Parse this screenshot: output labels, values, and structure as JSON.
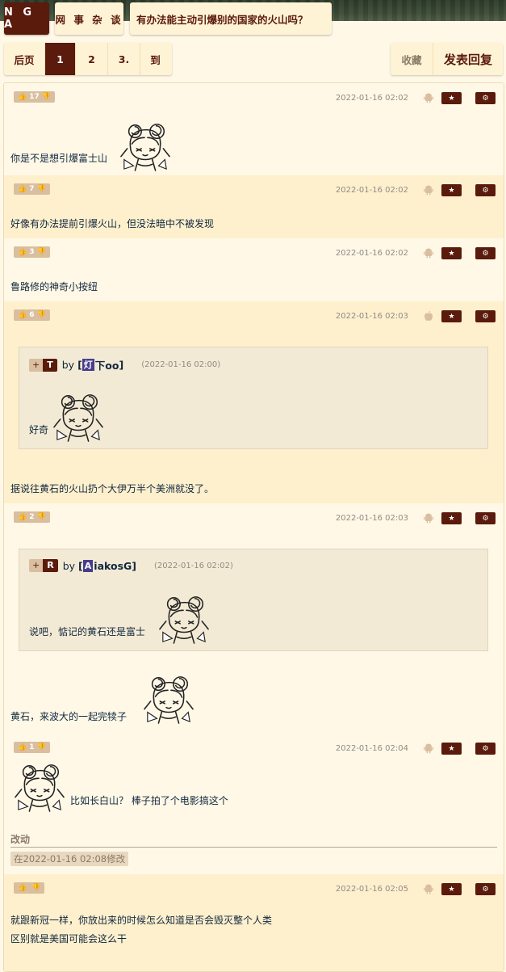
{
  "header": {
    "logo": "N G A",
    "forum": "网 事 杂 谈",
    "topic_title": "有办法能主动引爆别的国家的火山吗？"
  },
  "pager": {
    "prev_label": "后页",
    "pages": [
      "1",
      "2",
      "3."
    ],
    "current": "1",
    "goto_label": "到"
  },
  "actions": {
    "favorite_label": "收藏",
    "reply_label": "发表回复"
  },
  "colors": {
    "brand": "#5a1a0c",
    "bg_light": "#fff8e6",
    "bg_alt": "#fff0cd",
    "quote_bg": "#f3ead5"
  },
  "posts": [
    {
      "likes": "17",
      "date": "2022-01-16 02:02",
      "device": "android-icon",
      "content": "你是不是想引爆富士山"
    },
    {
      "likes": "7",
      "date": "2022-01-16 02:02",
      "device": "android-icon",
      "content": "好像有办法提前引爆火山，但没法暗中不被发现"
    },
    {
      "likes": "3",
      "date": "2022-01-16 02:02",
      "device": "android-icon",
      "content": "鲁路修的神奇小按纽"
    },
    {
      "likes": "6",
      "date": "2022-01-16 02:03",
      "device": "apple-icon",
      "quote": {
        "tag": "T",
        "by": "by",
        "user_avatar": "灯",
        "user": "下oo",
        "date": "(2022-01-16 02:00)",
        "text": "好奇"
      },
      "content": "据说往黄石的火山扔个大伊万半个美洲就没了。"
    },
    {
      "likes": "2",
      "date": "2022-01-16 02:03",
      "device": "android-icon",
      "quote": {
        "tag": "R",
        "by": "by",
        "user_avatar": "A",
        "user": "iakosG",
        "date": "(2022-01-16 02:02)",
        "text": "说吧，惦记的黄石还是富士"
      },
      "content": "黄石，来波大的一起完犊子"
    },
    {
      "likes": "1",
      "date": "2022-01-16 02:04",
      "device": "android-icon",
      "content": "比如长白山？ 棒子拍了个电影搞这个",
      "edit_title": "改动",
      "edit_note": "在2022-01-16 02:08修改"
    },
    {
      "likes": "",
      "date": "2022-01-16 02:05",
      "device": "android-icon",
      "content_line1": "就跟新冠一样，你放出来的时候怎么知道是否会毁灭整个人类",
      "content_line2": "区别就是美国可能会这么干"
    }
  ],
  "icons": {
    "like": "thumbs-up-icon",
    "dislike": "thumbs-down-icon",
    "star": "star-icon",
    "settings": "gear-icon"
  }
}
